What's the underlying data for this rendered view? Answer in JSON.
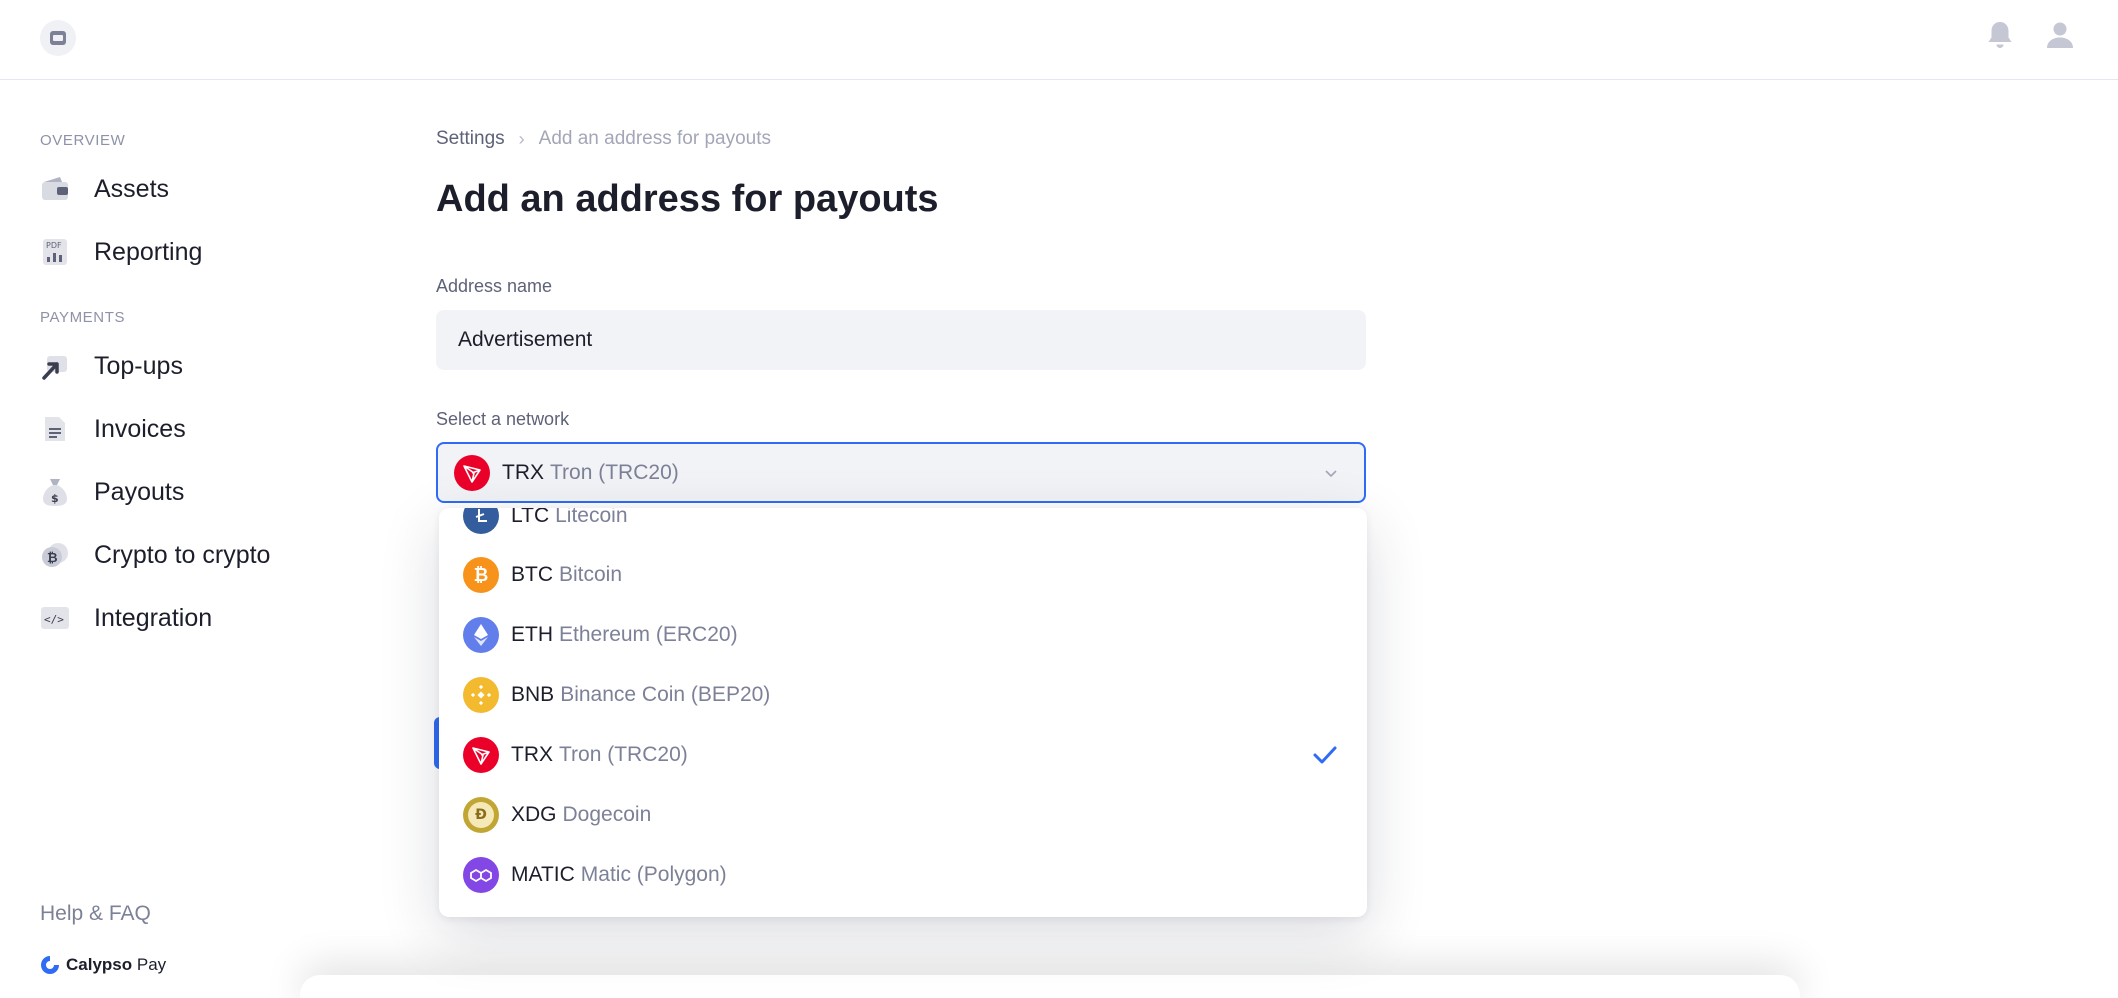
{
  "header": {
    "logo_icon": "app-logo-icon",
    "notifications_icon": "bell-icon",
    "profile_icon": "user-icon"
  },
  "sidebar": {
    "sections": [
      {
        "label": "OVERVIEW",
        "items": [
          {
            "label": "Assets",
            "icon": "wallet-icon"
          },
          {
            "label": "Reporting",
            "icon": "pdf-report-icon"
          }
        ]
      },
      {
        "label": "PAYMENTS",
        "items": [
          {
            "label": "Top-ups",
            "icon": "top-up-arrow-icon"
          },
          {
            "label": "Invoices",
            "icon": "document-icon"
          },
          {
            "label": "Payouts",
            "icon": "money-bag-icon"
          },
          {
            "label": "Crypto to crypto",
            "icon": "coins-icon"
          },
          {
            "label": "Integration",
            "icon": "code-icon"
          }
        ]
      }
    ],
    "help": "Help & FAQ",
    "brand": {
      "name_bold": "Calypso",
      "name_regular": "Pay"
    }
  },
  "breadcrumb": {
    "parent": "Settings",
    "current": "Add an address for payouts"
  },
  "page_title": "Add an address for payouts",
  "form": {
    "address_name": {
      "label": "Address name",
      "value": "Advertisement"
    },
    "network": {
      "label": "Select a network",
      "selected": {
        "symbol": "TRX",
        "name": "Tron (TRC20)"
      },
      "options": [
        {
          "symbol": "LTC",
          "name": "Litecoin",
          "color": "#345d9d"
        },
        {
          "symbol": "BTC",
          "name": "Bitcoin",
          "color": "#f7931a"
        },
        {
          "symbol": "ETH",
          "name": "Ethereum (ERC20)",
          "color": "#627eea"
        },
        {
          "symbol": "BNB",
          "name": "Binance Coin (BEP20)",
          "color": "#f3ba2f"
        },
        {
          "symbol": "TRX",
          "name": "Tron (TRC20)",
          "color": "#eb0029",
          "selected": true
        },
        {
          "symbol": "XDG",
          "name": "Dogecoin",
          "color": "#c2a633"
        },
        {
          "symbol": "MATIC",
          "name": "Matic (Polygon)",
          "color": "#8247e5"
        }
      ]
    }
  },
  "colors": {
    "accent": "#2f6bf5",
    "muted_text": "#7d8197"
  }
}
